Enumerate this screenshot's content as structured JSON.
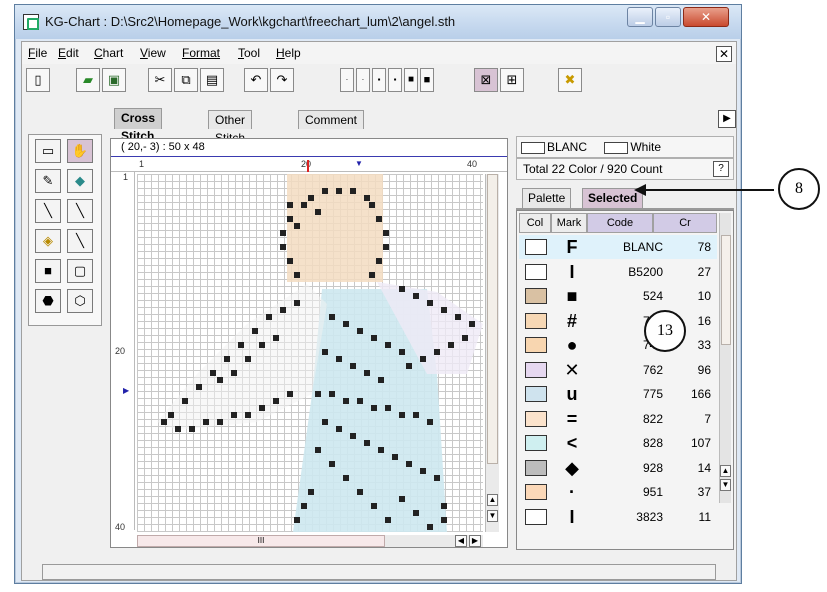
{
  "window": {
    "title": "KG-Chart : D:\\Src2\\Homepage_Work\\kgchart\\freechart_lum\\2\\angel.sth"
  },
  "menu": {
    "items": [
      {
        "first": "F",
        "rest": "ile"
      },
      {
        "first": "E",
        "rest": "dit"
      },
      {
        "first": "C",
        "rest": "hart"
      },
      {
        "first": "V",
        "rest": "iew"
      },
      {
        "first": "Format",
        "rest": ""
      },
      {
        "first": "T",
        "rest": "ool"
      },
      {
        "first": "H",
        "rest": "elp"
      }
    ]
  },
  "tabs": [
    "Cross Stitch",
    "Other Stitch",
    "Comment"
  ],
  "chart": {
    "coord": "( 20,- 3)   : 50 x 48",
    "ruler_top": [
      "1",
      "20",
      "40"
    ],
    "ruler_left": [
      "1",
      "20",
      "40"
    ],
    "hscroll_grip": "III"
  },
  "panel": {
    "color_left": "BLANC",
    "color_right": "White",
    "total": "Total 22 Color / 920 Count",
    "info_btn": "?",
    "ptabs": [
      "Palette",
      "Selected"
    ],
    "columns": [
      "Col",
      "Mark",
      "Code",
      "Cr"
    ],
    "rows": [
      {
        "color": "#ffffff",
        "mark": "F",
        "code": "BLANC",
        "count": "78"
      },
      {
        "color": "#ffffff",
        "mark": "I",
        "code": "B5200",
        "count": "27"
      },
      {
        "color": "#d9c1a3",
        "mark": "■",
        "code": "524",
        "count": "10"
      },
      {
        "color": "#f7d8b5",
        "mark": "#",
        "code": "739",
        "count": "16"
      },
      {
        "color": "#f8d6b0",
        "mark": "●",
        "code": "745",
        "count": "33"
      },
      {
        "color": "#e6d8f0",
        "mark": "✕",
        "code": "762",
        "count": "96"
      },
      {
        "color": "#cfe3ee",
        "mark": "u",
        "code": "775",
        "count": "166"
      },
      {
        "color": "#fbe3cc",
        "mark": "=",
        "code": "822",
        "count": "7"
      },
      {
        "color": "#cfeff0",
        "mark": "<",
        "code": "828",
        "count": "107"
      },
      {
        "color": "#bcbcbc",
        "mark": "◆",
        "code": "928",
        "count": "14"
      },
      {
        "color": "#fbd8b8",
        "mark": "·",
        "code": "951",
        "count": "37"
      },
      {
        "color": "#ffffff",
        "mark": "I",
        "code": "3823",
        "count": "11"
      }
    ]
  },
  "callouts": {
    "selected_tab": "8",
    "table": "13"
  },
  "icons": {
    "new": "new-document-icon",
    "open": "open-folder-icon",
    "save": "save-icon",
    "cut": "cut-icon",
    "copy": "copy-icon",
    "paste": "paste-icon",
    "undo": "undo-icon",
    "redo": "redo-icon"
  }
}
